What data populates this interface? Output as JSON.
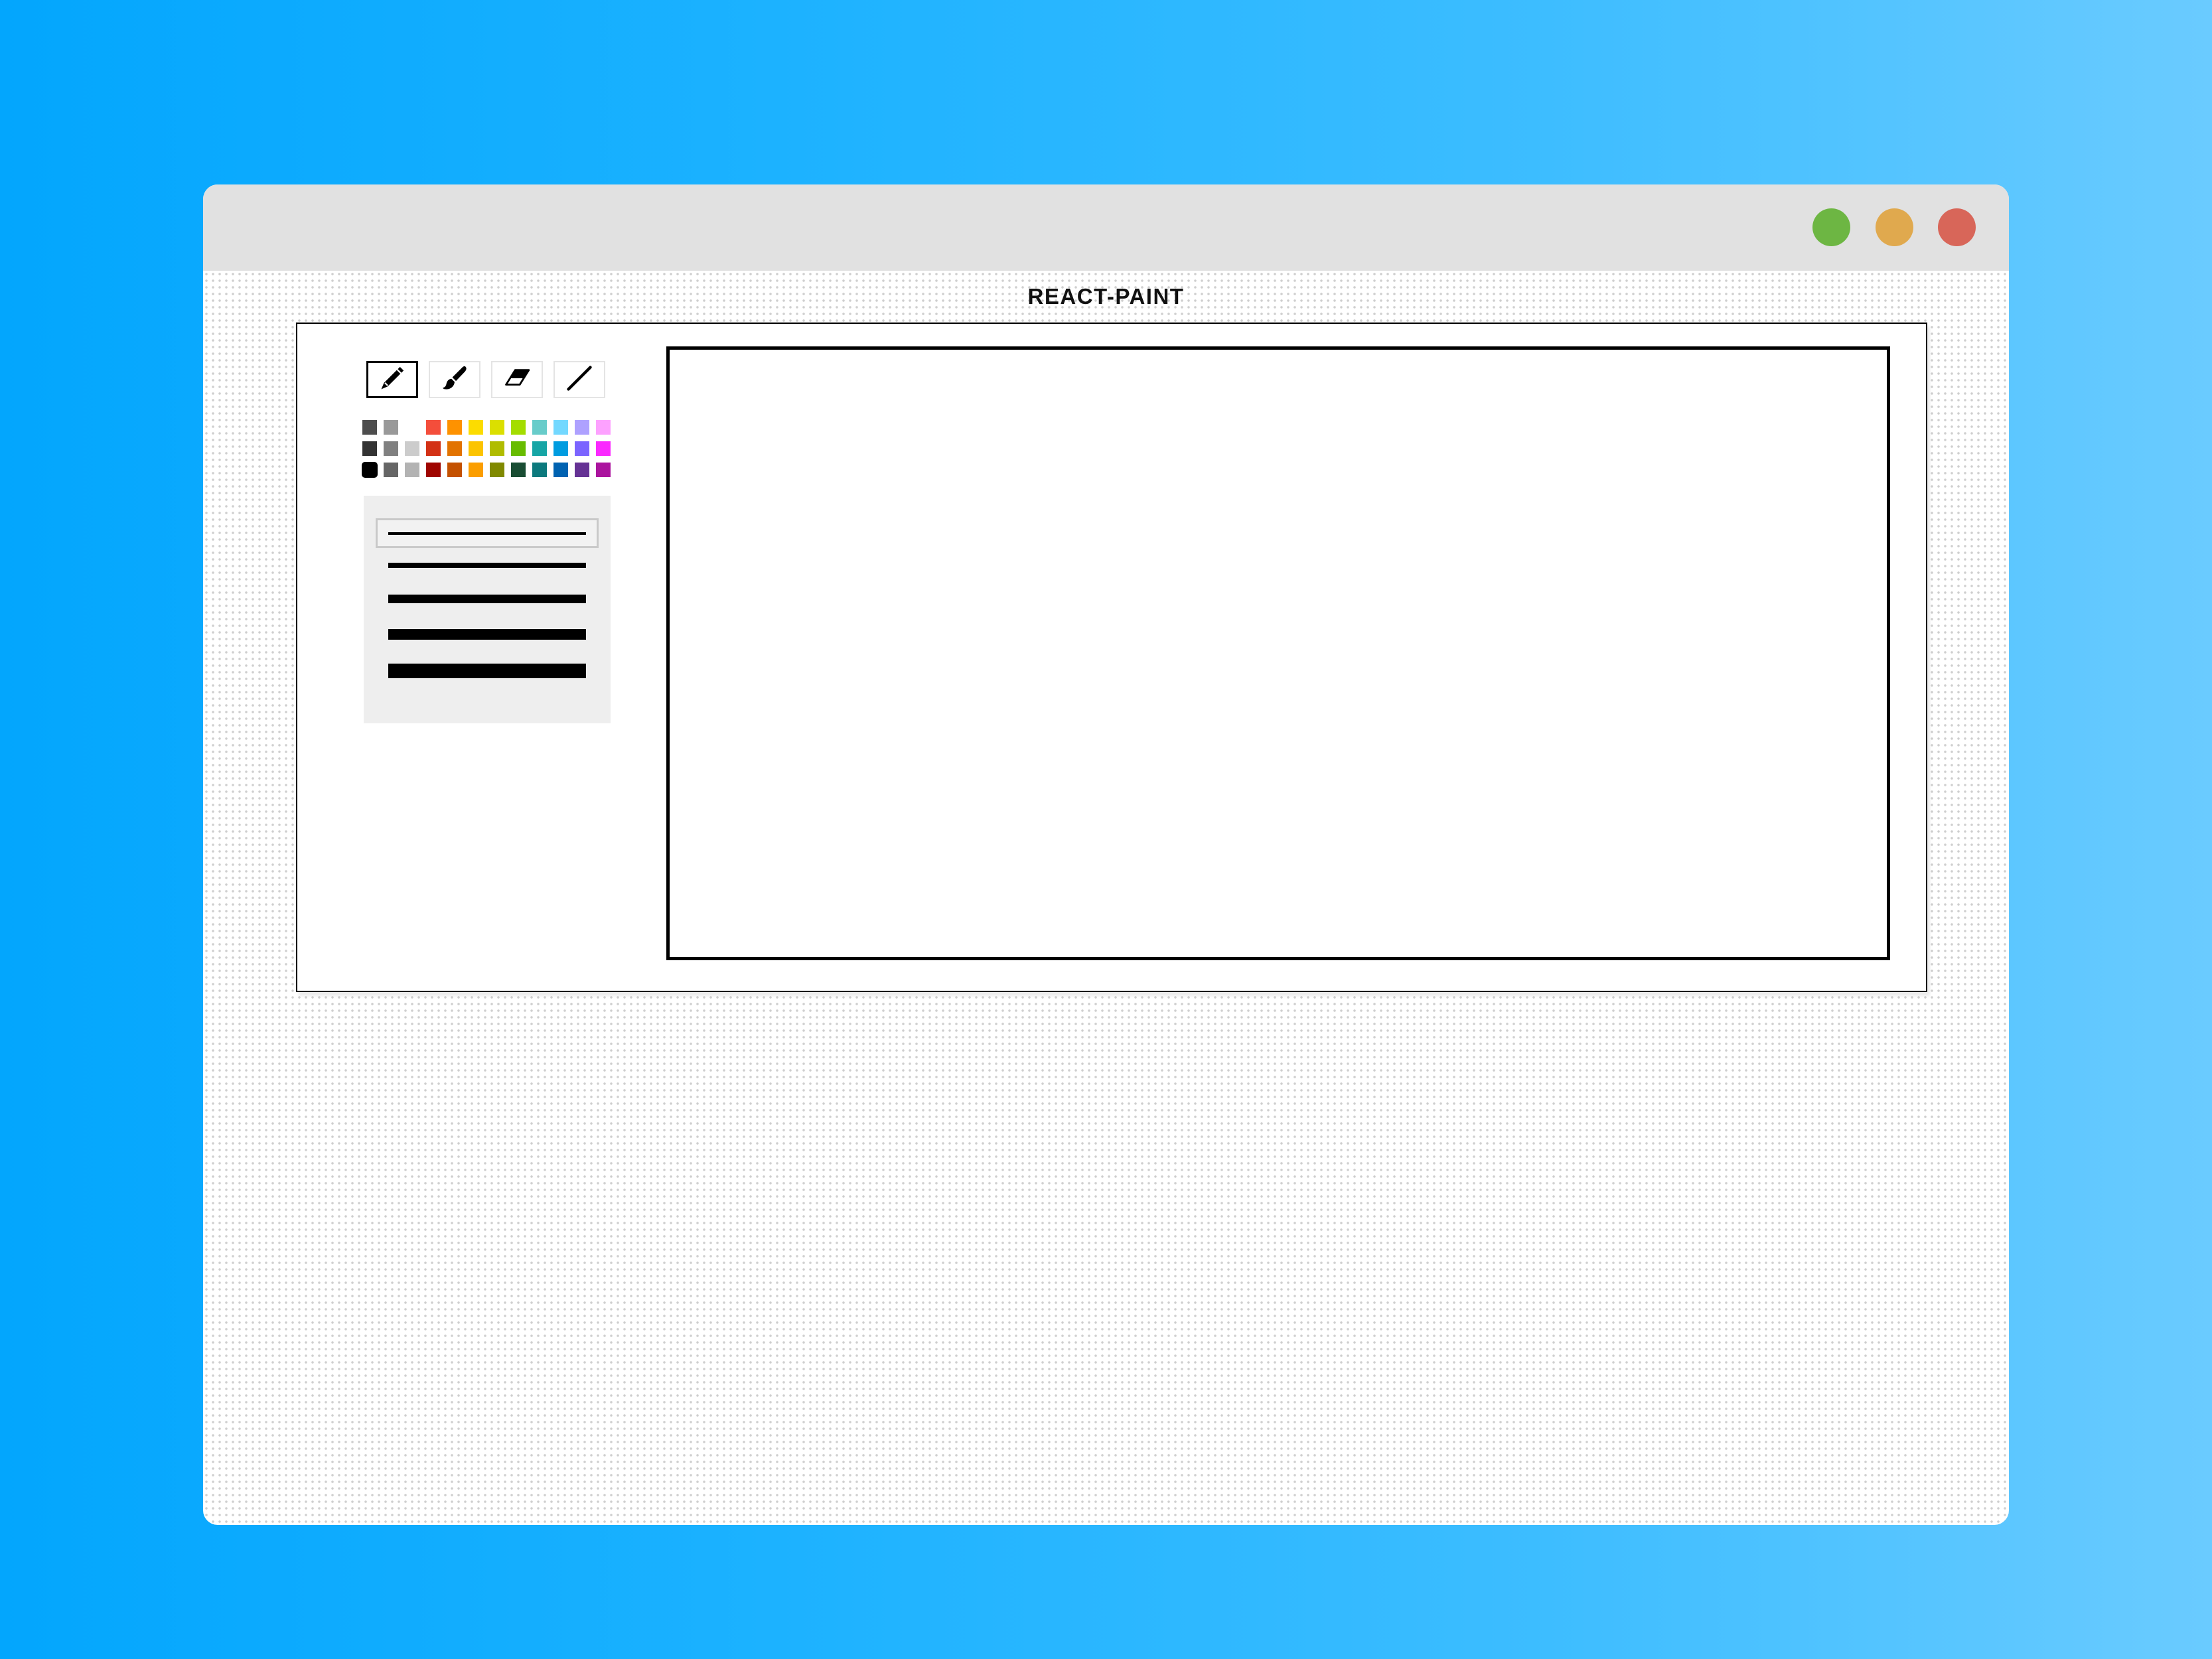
{
  "window": {
    "controls": [
      {
        "name": "maximize-button",
        "color": "#6db643"
      },
      {
        "name": "minimize-button",
        "color": "#e0a94e"
      },
      {
        "name": "close-button",
        "color": "#d86659"
      }
    ]
  },
  "app": {
    "title": "REACT-PAINT"
  },
  "tools": [
    {
      "name": "pencil",
      "icon": "pencil-icon",
      "selected": true
    },
    {
      "name": "brush",
      "icon": "brush-icon",
      "selected": false
    },
    {
      "name": "eraser",
      "icon": "eraser-icon",
      "selected": false
    },
    {
      "name": "line",
      "icon": "line-icon",
      "selected": false
    }
  ],
  "palette": {
    "rows": [
      [
        "#4d4d4d",
        "#999999",
        "#ffffff",
        "#f44e3b",
        "#fe9200",
        "#fcdc00",
        "#dbdf00",
        "#a4dd00",
        "#68ccca",
        "#73d8ff",
        "#aea1ff",
        "#fda1ff"
      ],
      [
        "#333333",
        "#808080",
        "#cccccc",
        "#d33115",
        "#e27300",
        "#fcc400",
        "#b0bc00",
        "#68bc00",
        "#16a5a5",
        "#009ce0",
        "#7b64ff",
        "#fa28ff"
      ],
      [
        "#000000",
        "#666666",
        "#b3b3b3",
        "#9f0500",
        "#c45100",
        "#fb9e00",
        "#808900",
        "#194d33",
        "#0c797d",
        "#0062b1",
        "#653294",
        "#ab149e"
      ]
    ],
    "selected": "#000000"
  },
  "brush_sizes": {
    "options": [
      2,
      4,
      7,
      9,
      13
    ],
    "selected": 2
  }
}
